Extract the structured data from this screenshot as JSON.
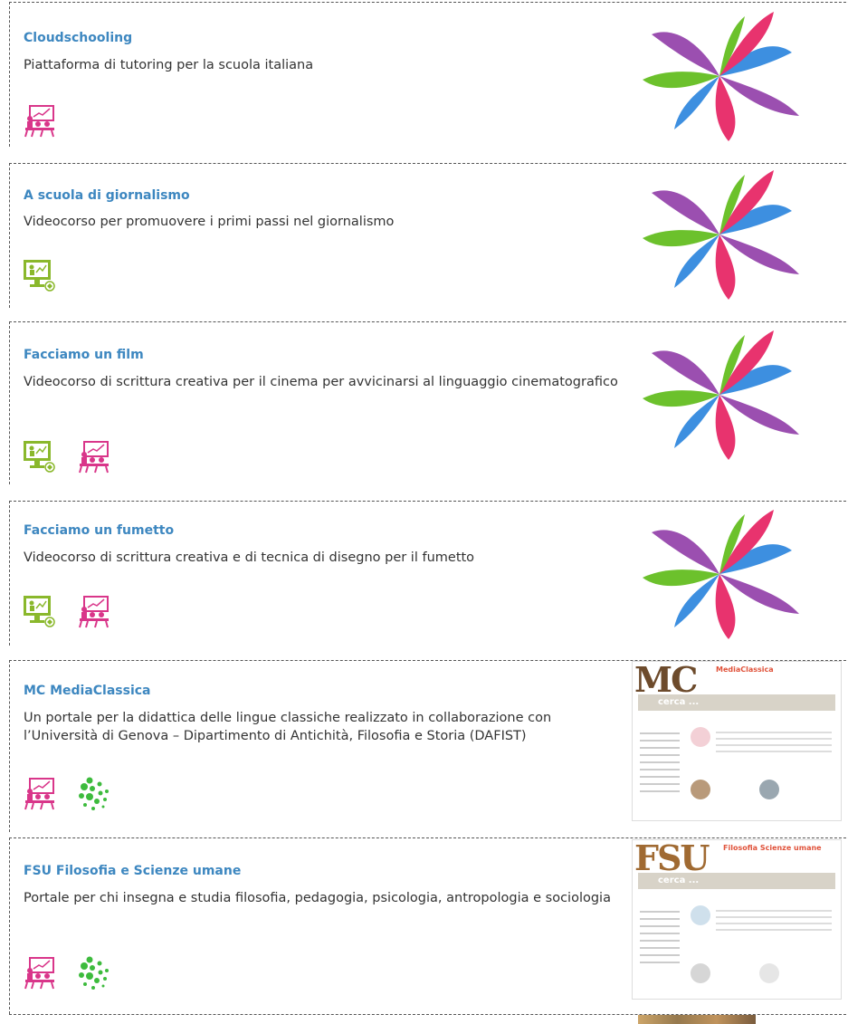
{
  "items": [
    {
      "title": "Cloudschooling",
      "description": "Piattaforma di tutoring per la scuola italiana",
      "icons": [
        "classroom-icon"
      ],
      "thumbnail": "ribbon-logo"
    },
    {
      "title": "A scuola di giornalismo",
      "description": "Videocorso per promuovere i primi passi nel giornalismo",
      "icons": [
        "video-course-icon"
      ],
      "thumbnail": "ribbon-logo"
    },
    {
      "title": "Facciamo un film",
      "description": "Videocorso di scrittura creativa per il cinema per avvicinarsi al linguaggio cinematografico",
      "icons": [
        "video-course-icon",
        "classroom-icon"
      ],
      "thumbnail": "ribbon-logo"
    },
    {
      "title": "Facciamo un fumetto",
      "description": "Videocorso di scrittura creativa e di tecnica di disegno per il fumetto",
      "icons": [
        "video-course-icon",
        "classroom-icon"
      ],
      "thumbnail": "ribbon-logo"
    },
    {
      "title": "MC MediaClassica",
      "description": "Un portale per la didattica delle lingue classiche realizzato in collaborazione con l’Università di Genova – Dipartimento di Antichità, Filosofia e Storia (DAFIST)",
      "icons": [
        "classroom-icon",
        "dots-network-icon"
      ],
      "thumbnail": "site-screenshot",
      "thumb_logo": "MC",
      "thumb_brand": "MediaClassica",
      "thumb_search": "cerca ..."
    },
    {
      "title": "FSU Filosofia e Scienze umane",
      "description": "Portale per chi insegna e studia filosofia, pedagogia, psicologia, antropologia e sociologia",
      "icons": [
        "classroom-icon",
        "dots-network-icon"
      ],
      "thumbnail": "site-screenshot",
      "thumb_logo": "FSU",
      "thumb_brand": "Filosofia Scienze umane",
      "thumb_search": "cerca ..."
    }
  ],
  "colors": {
    "title": "#3d87c0",
    "magenta": "#d9368a",
    "green": "#8ab82c",
    "dots": "#3dbb3d",
    "purple": "#9b4fb0",
    "blue": "#3d8fe0",
    "lime": "#6cc12c",
    "pink": "#e8336e"
  }
}
